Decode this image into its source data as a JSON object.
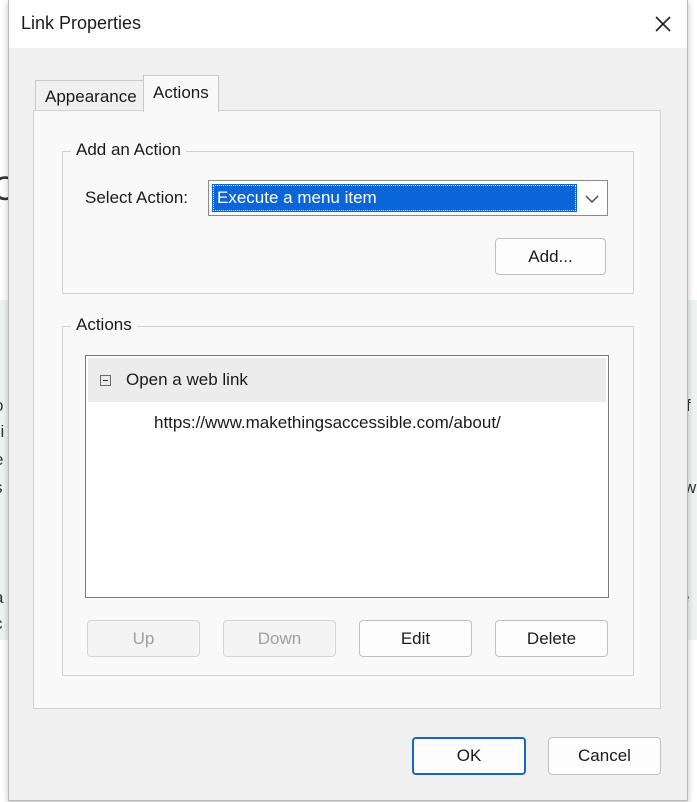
{
  "background": {
    "left_fragments": [
      "o",
      "si",
      "e",
      "s",
      "r",
      "ti",
      "a",
      "c"
    ],
    "right_fragments": [
      "f",
      "wi",
      "e f"
    ],
    "big_letter": "C"
  },
  "dialog": {
    "title": "Link Properties",
    "close_icon": "close-icon"
  },
  "tabs": [
    {
      "label": "Appearance",
      "active": false
    },
    {
      "label": "Actions",
      "active": true
    }
  ],
  "add_action": {
    "legend": "Add an Action",
    "select_label": "Select Action:",
    "select_value": "Execute a menu item",
    "add_button": "Add..."
  },
  "actions": {
    "legend": "Actions",
    "tree": {
      "parent": "Open a web link",
      "child": "https://www.makethingsaccessible.com/about/"
    },
    "buttons": {
      "up": "Up",
      "down": "Down",
      "edit": "Edit",
      "delete": "Delete"
    }
  },
  "footer": {
    "ok": "OK",
    "cancel": "Cancel"
  },
  "colors": {
    "accent": "#1966c2",
    "selection": "#0a66d8"
  }
}
